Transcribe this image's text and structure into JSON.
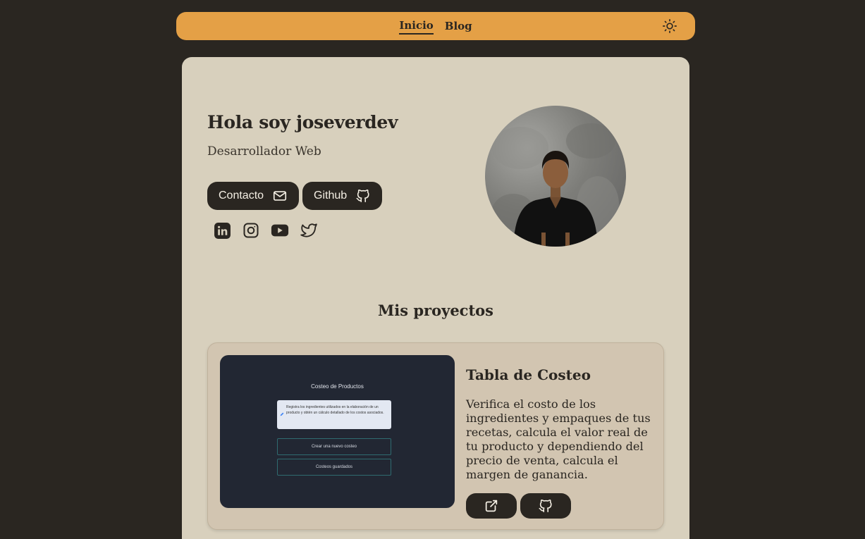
{
  "nav": {
    "links": [
      {
        "label": "Inicio",
        "active": true
      },
      {
        "label": "Blog",
        "active": false
      }
    ],
    "theme_icon": "sun-icon"
  },
  "hero": {
    "title": "Hola soy joseverdev",
    "subtitle": "Desarrollador Web",
    "buttons": [
      {
        "label": "Contacto",
        "icon": "mail-icon"
      },
      {
        "label": "Github",
        "icon": "github-icon"
      }
    ],
    "socials": [
      "linkedin-icon",
      "instagram-icon",
      "youtube-icon",
      "twitter-icon"
    ]
  },
  "projects": {
    "section_title": "Mis proyectos",
    "items": [
      {
        "title": "Tabla de Costeo",
        "description": "Verifica el costo de los ingredientes y empaques de tus recetas, calcula el valor real de tu producto y dependiendo del precio de venta, calcula el margen de ganancia.",
        "preview": {
          "title": "Costeo de Productos",
          "note": "Registra los ingredientes utilizados en la elaboración de un producto y obtén un cálculo detallado de los costos asociados.",
          "button_new": "Crear una nuevo costeo",
          "button_saved": "Costeos guardados"
        },
        "actions": [
          "external-link-icon",
          "github-icon"
        ]
      }
    ]
  },
  "colors": {
    "background": "#2a2621",
    "navbar": "#e4a046",
    "card": "#d8d0bd",
    "project_card": "#d2c5b1",
    "dark": "#2a2621"
  }
}
